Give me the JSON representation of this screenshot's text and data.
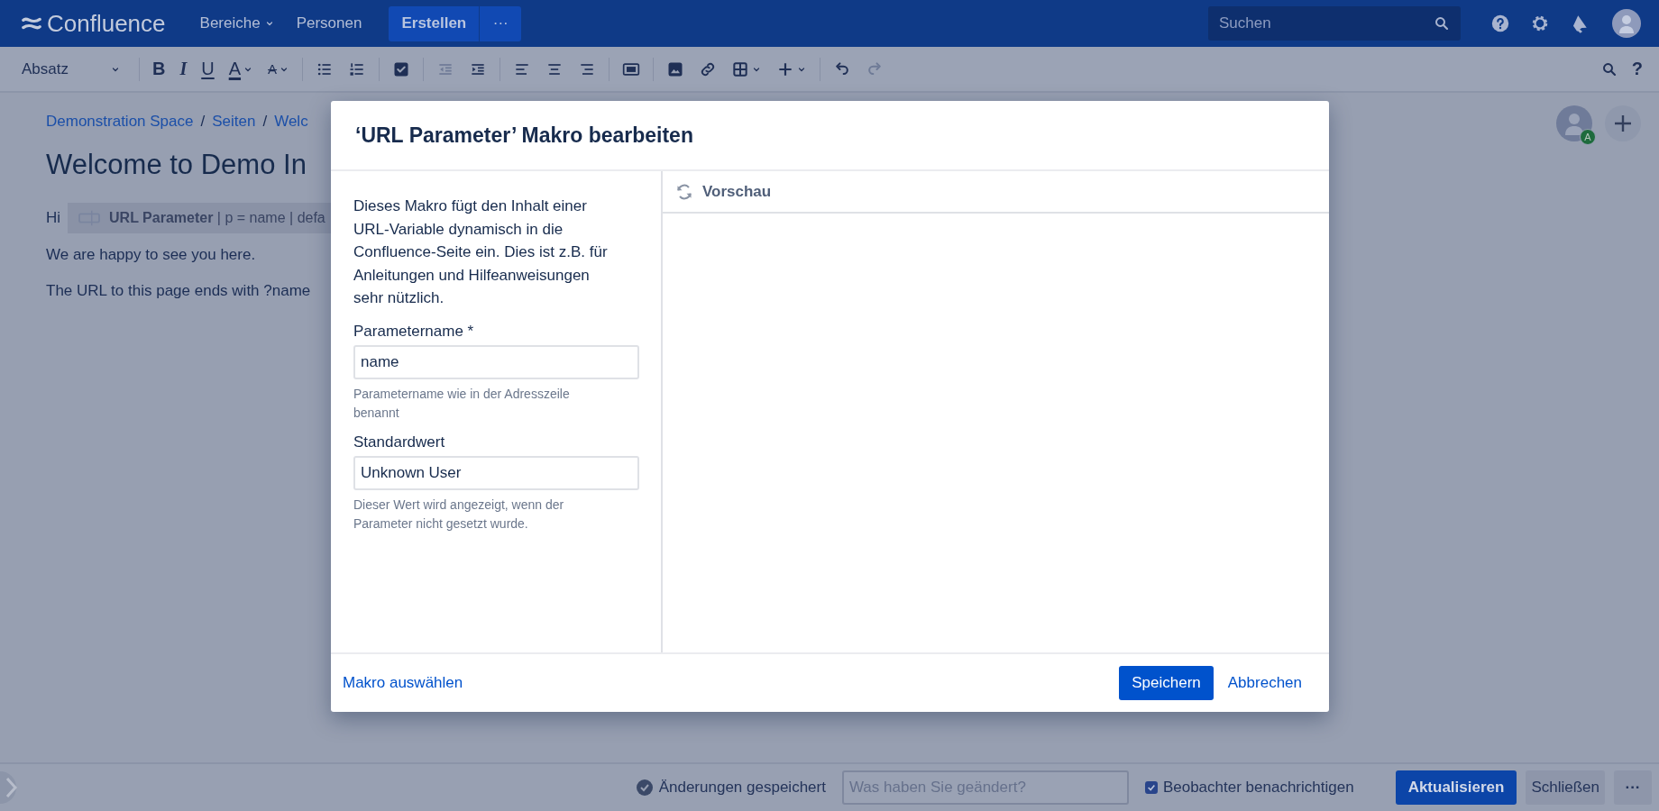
{
  "header": {
    "logo": "Confluence",
    "nav": [
      {
        "label": "Bereiche",
        "dropdown": true
      },
      {
        "label": "Personen",
        "dropdown": false
      }
    ],
    "create": "Erstellen",
    "create_more": "···",
    "search": {
      "placeholder": "Suchen"
    }
  },
  "toolbar": {
    "style": "Absatz",
    "groups": [
      [
        {
          "kind": "bold",
          "glyph": "B",
          "dropdown": false,
          "disabled": false
        },
        {
          "kind": "italic",
          "glyph": "I",
          "dropdown": false,
          "disabled": false
        },
        {
          "kind": "underline",
          "glyph": "U",
          "dropdown": false,
          "disabled": false
        },
        {
          "kind": "text-color",
          "glyph": "A",
          "dropdown": true,
          "disabled": false
        },
        {
          "kind": "more-format",
          "glyph": "A",
          "dropdown": true,
          "disabled": false
        }
      ],
      [
        {
          "kind": "bullets",
          "dropdown": false,
          "disabled": false
        },
        {
          "kind": "numbers",
          "dropdown": false,
          "disabled": false
        }
      ],
      [
        {
          "kind": "task",
          "dropdown": false,
          "disabled": false
        }
      ],
      [
        {
          "kind": "outdent",
          "dropdown": false,
          "disabled": true
        },
        {
          "kind": "indent",
          "dropdown": false,
          "disabled": false
        }
      ],
      [
        {
          "kind": "align-left",
          "dropdown": false,
          "disabled": false
        },
        {
          "kind": "align-center",
          "dropdown": false,
          "disabled": false
        },
        {
          "kind": "align-right",
          "dropdown": false,
          "disabled": false
        }
      ],
      [
        {
          "kind": "layout",
          "dropdown": false,
          "disabled": false
        }
      ],
      [
        {
          "kind": "image",
          "dropdown": false,
          "disabled": false
        },
        {
          "kind": "link",
          "dropdown": false,
          "disabled": false
        },
        {
          "kind": "table",
          "dropdown": true,
          "disabled": false
        },
        {
          "kind": "insert",
          "dropdown": true,
          "disabled": false
        }
      ],
      [
        {
          "kind": "undo",
          "dropdown": false,
          "disabled": false
        },
        {
          "kind": "redo",
          "dropdown": false,
          "disabled": true
        }
      ]
    ],
    "help": "?"
  },
  "page": {
    "breadcrumbs": [
      {
        "label": "Demonstration Space",
        "separator": "/"
      },
      {
        "label": "Seiten",
        "separator": "/"
      },
      {
        "label": "Welc"
      }
    ],
    "title": "Welcome to Demo In",
    "greeting": "Hi",
    "macro": "**URL Parameter** | p = name | defa",
    "lines": [
      "We are happy to see you here.",
      "The URL to this page ends with ?name"
    ],
    "avatar_badge": "A"
  },
  "dialog": {
    "title": "‘URL Parameter’ Makro bearbeiten",
    "description": "Dieses Makro fügt den Inhalt einer URL-Variable dynamisch in die Confluence-Seite ein. Dies ist z.B. für Anleitungen und Hilfeanweisungen sehr nützlich.",
    "fields": [
      {
        "label": "Parametername *",
        "value": "name",
        "hint": "Parametername wie in der Adresszeile benannt"
      },
      {
        "label": "Standardwert",
        "value": "Unknown User",
        "hint": "Dieser Wert wird angezeigt, wenn der Parameter nicht gesetzt wurde."
      }
    ],
    "preview": "Vorschau",
    "select_macro": "Makro auswählen",
    "save": "Speichern",
    "cancel": "Abbrechen"
  },
  "footer": {
    "status": "Änderungen gespeichert",
    "comment": {
      "placeholder": "Was haben Sie geändert?"
    },
    "notify": {
      "label": "Beobachter benachrichtigen",
      "checked": true
    },
    "update": "Aktualisieren",
    "close": "Schließen",
    "more": "···"
  }
}
